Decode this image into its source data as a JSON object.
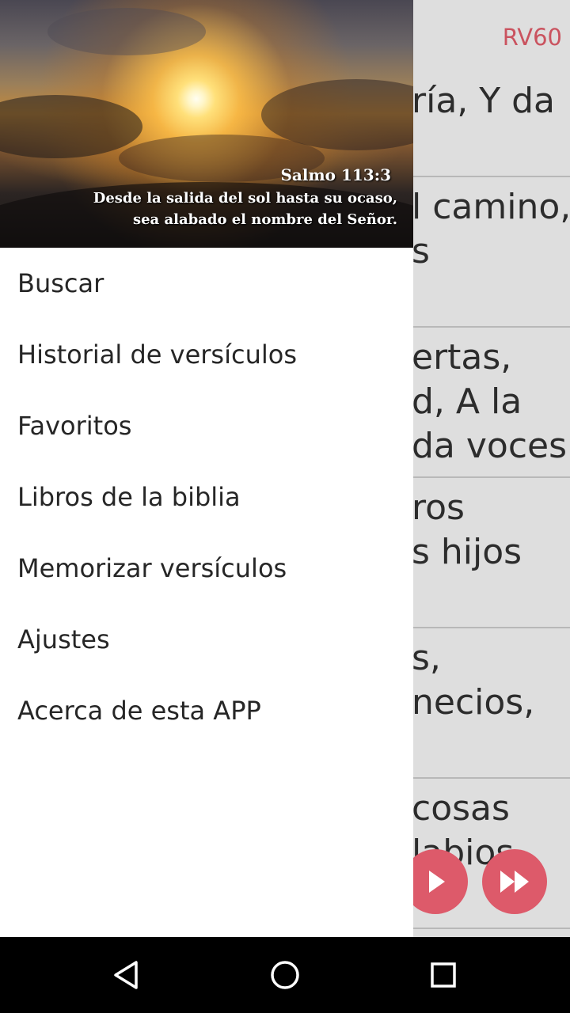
{
  "app": {
    "version_label": "RV60",
    "verses": [
      {
        "lines": [
          "ría, Y da"
        ]
      },
      {
        "lines": [
          "l camino,",
          "s"
        ]
      },
      {
        "lines": [
          "ertas,",
          "d, A la",
          "da voces:"
        ]
      },
      {
        "lines": [
          "ros",
          "s hijos"
        ]
      },
      {
        "lines": [
          "s,",
          "necios,"
        ]
      },
      {
        "lines": [
          "cosas",
          "labios"
        ]
      }
    ],
    "controls": {
      "play_icon": "play-icon",
      "fast_forward_icon": "fast-forward-icon",
      "accent_color": "#dd5a6a"
    }
  },
  "drawer": {
    "header": {
      "reference": "Salmo 113:3",
      "text_line1": "Desde la salida del sol hasta su ocaso,",
      "text_line2": "sea alabado el nombre del Señor."
    },
    "menu": [
      {
        "label": "Buscar"
      },
      {
        "label": "Historial de versículos"
      },
      {
        "label": "Favoritos"
      },
      {
        "label": "Libros de la biblia"
      },
      {
        "label": "Memorizar versículos"
      },
      {
        "label": "Ajustes"
      },
      {
        "label": "Acerca de esta APP"
      }
    ]
  },
  "navbar": {
    "back_icon": "back-icon",
    "home_icon": "home-icon",
    "recents_icon": "recents-icon"
  }
}
